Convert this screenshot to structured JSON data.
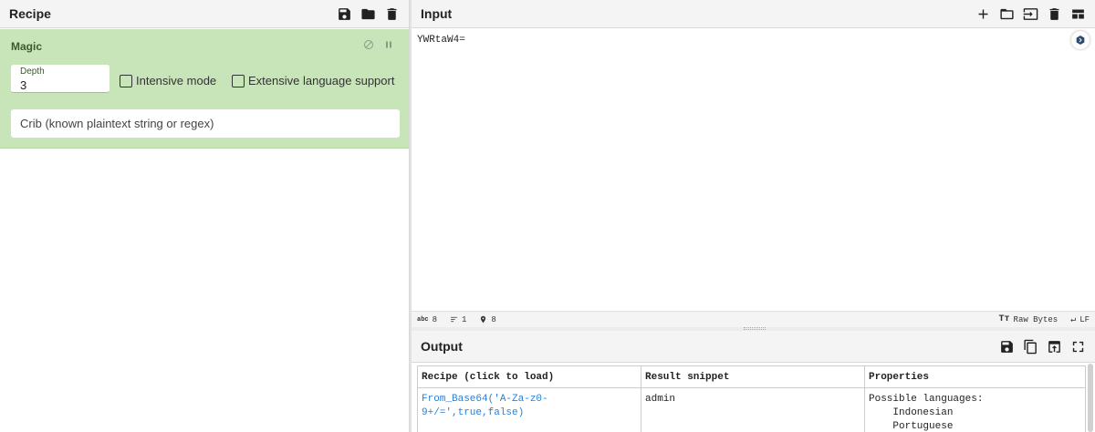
{
  "recipe": {
    "title": "Recipe",
    "operation": {
      "name": "Magic",
      "depth_label": "Depth",
      "depth_value": "3",
      "intensive_label": "Intensive mode",
      "extensive_label": "Extensive language support",
      "crib_placeholder": "Crib (known plaintext string or regex)"
    }
  },
  "input": {
    "title": "Input",
    "text": "YWRtaW4=",
    "status": {
      "chars": "8",
      "lines": "1",
      "position": "8",
      "encoding": "Raw Bytes",
      "eol": "LF"
    }
  },
  "output": {
    "title": "Output",
    "columns": [
      "Recipe (click to load)",
      "Result snippet",
      "Properties"
    ],
    "rows": [
      {
        "recipe_line1": "From_Base64('A-Za-z0-",
        "recipe_line2": "9+/=',true,false)",
        "result": "admin",
        "props_title": "Possible languages:",
        "props_lang1": "    Indonesian",
        "props_lang2": "    Portuguese"
      }
    ]
  },
  "icons": {
    "save": "save-icon",
    "folder": "folder-icon",
    "trash": "trash-icon",
    "plus": "plus-icon",
    "copy": "copy-icon",
    "maximize": "maximize-icon"
  },
  "colors": {
    "op_bg": "#c7e5b9",
    "link": "#2a7fd4"
  }
}
